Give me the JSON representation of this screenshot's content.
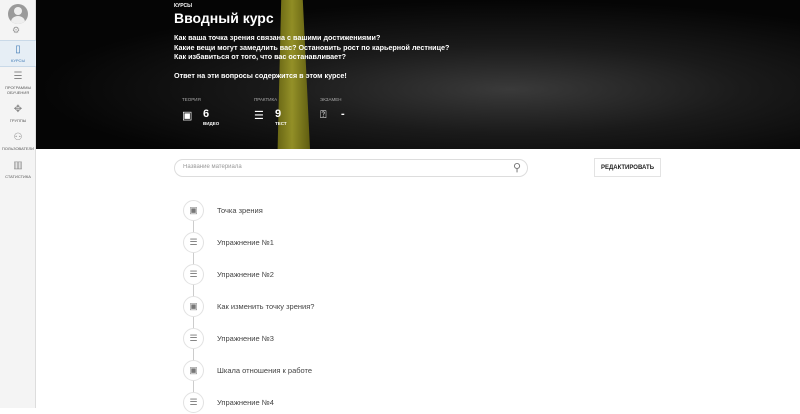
{
  "sidebar": {
    "items": [
      {
        "label": "КУРСЫ",
        "icon": "course-icon"
      },
      {
        "label": "ПРОГРАММЫ ОБУЧЕНИЯ",
        "icon": "programs-icon"
      },
      {
        "label": "ГРУППЫ",
        "icon": "groups-icon"
      },
      {
        "label": "ПОЛЬЗОВАТЕЛИ",
        "icon": "users-icon"
      },
      {
        "label": "СТАТИСТИКА",
        "icon": "stats-icon"
      }
    ]
  },
  "hero": {
    "breadcrumb": "КУРСЫ",
    "title": "Вводный курс",
    "description": [
      "Как ваша точка зрения связана с вашими достижениями?",
      "Какие вещи могут замедлить вас? Остановить рост по карьерной лестнице?",
      "Как избавиться от того, что вас останавливает?",
      "",
      "Ответ на эти вопросы содержится в этом курсе!"
    ],
    "stats": [
      {
        "label": "ТЕОРИЯ",
        "value": "6",
        "sub": "ВИДЕО"
      },
      {
        "label": "ПРАКТИКА",
        "value": "9",
        "sub": "ТЕСТ"
      },
      {
        "label": "ЭКЗАМЕН",
        "value": "-",
        "sub": ""
      }
    ]
  },
  "search": {
    "placeholder": "Название материала",
    "value": ""
  },
  "toolbar": {
    "edit_label": "РЕДАКТИРОВАТЬ"
  },
  "materials": [
    {
      "name": "Точка зрения",
      "type": "video"
    },
    {
      "name": "Упражнение №1",
      "type": "test"
    },
    {
      "name": "Упражнение №2",
      "type": "test"
    },
    {
      "name": "Как изменить точку зрения?",
      "type": "video"
    },
    {
      "name": "Упражнение №3",
      "type": "test"
    },
    {
      "name": "Шкала отношения к работе",
      "type": "video"
    },
    {
      "name": "Упражнение №4",
      "type": "test"
    }
  ]
}
